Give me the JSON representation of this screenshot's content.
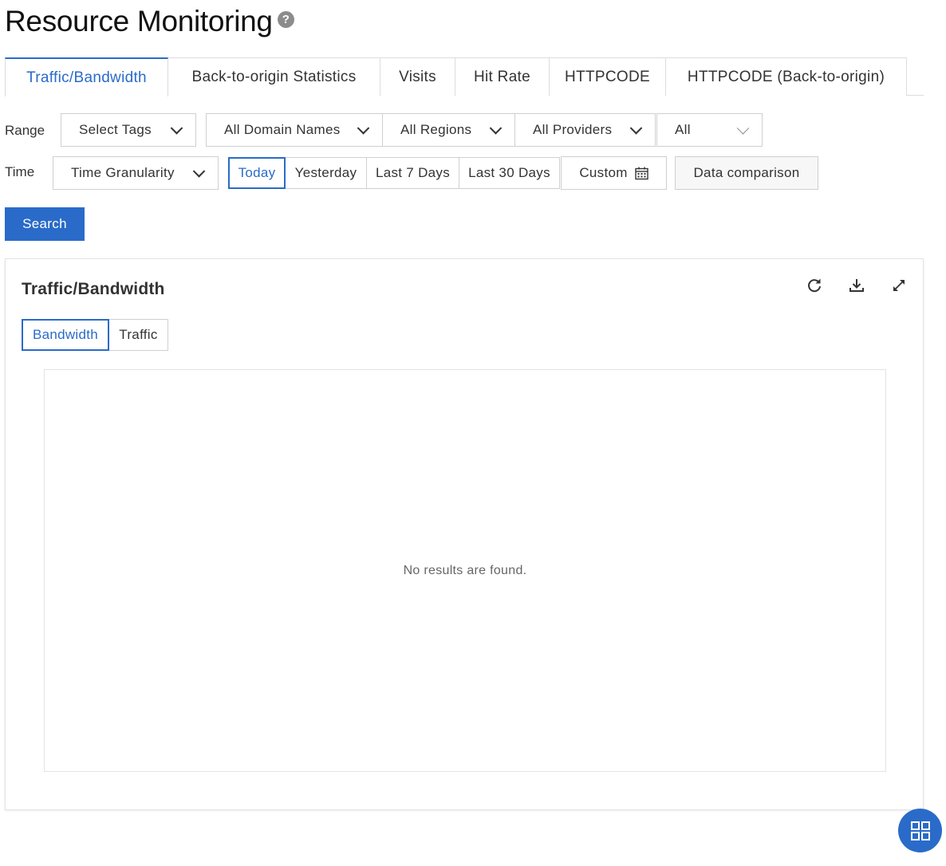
{
  "page": {
    "title": "Resource Monitoring"
  },
  "tabs": [
    {
      "label": "Traffic/Bandwidth",
      "active": true
    },
    {
      "label": "Back-to-origin Statistics"
    },
    {
      "label": "Visits"
    },
    {
      "label": "Hit Rate"
    },
    {
      "label": "HTTPCODE"
    },
    {
      "label": "HTTPCODE (Back-to-origin)"
    }
  ],
  "filters": {
    "range_label": "Range",
    "select_tags": "Select Tags",
    "domain": "All Domain Names",
    "regions": "All Regions",
    "providers": "All Providers",
    "protocol": "All",
    "time_label": "Time",
    "granularity": "Time Granularity",
    "presets": [
      "Today",
      "Yesterday",
      "Last 7 Days",
      "Last 30 Days"
    ],
    "custom": "Custom",
    "compare": "Data comparison",
    "search": "Search"
  },
  "panel": {
    "title": "Traffic/Bandwidth",
    "sub_tabs": [
      "Bandwidth",
      "Traffic"
    ],
    "empty_message": "No results are found."
  },
  "colors": {
    "accent": "#2a6bc9"
  }
}
